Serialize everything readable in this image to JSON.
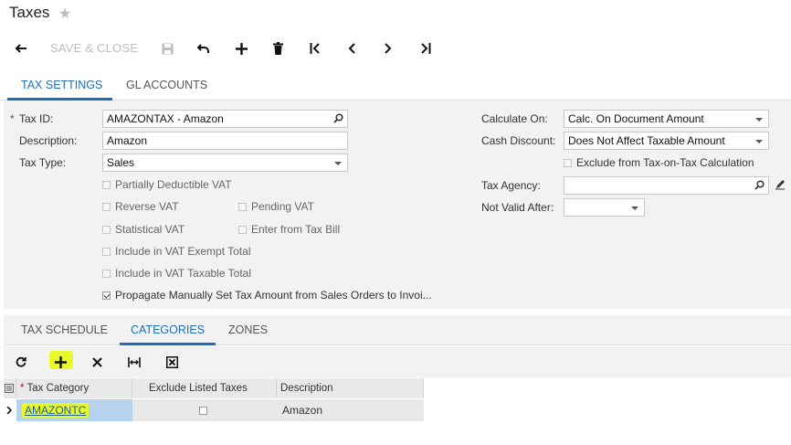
{
  "page": {
    "title": "Taxes"
  },
  "toolbar": {
    "save_close": "SAVE & CLOSE"
  },
  "tabs": {
    "tax_settings": "TAX SETTINGS",
    "gl_accounts": "GL ACCOUNTS"
  },
  "form": {
    "required_mark": "*",
    "tax_id_label": "Tax ID:",
    "tax_id_value": "AMAZONTAX - Amazon",
    "description_label": "Description:",
    "description_value": "Amazon",
    "tax_type_label": "Tax Type:",
    "tax_type_value": "Sales",
    "partially_deductible": "Partially Deductible VAT",
    "reverse_vat": "Reverse VAT",
    "pending_vat": "Pending VAT",
    "statistical_vat": "Statistical VAT",
    "enter_from_bill": "Enter from Tax Bill",
    "include_exempt": "Include in VAT Exempt Total",
    "include_taxable": "Include in VAT Taxable Total",
    "propagate": "Propagate Manually Set Tax Amount from Sales Orders to Invoi...",
    "calculate_on_label": "Calculate On:",
    "calculate_on_value": "Calc. On Document Amount",
    "cash_discount_label": "Cash Discount:",
    "cash_discount_value": "Does Not Affect Taxable Amount",
    "exclude_tax_on_tax": "Exclude from Tax-on-Tax Calculation",
    "tax_agency_label": "Tax Agency:",
    "tax_agency_value": "",
    "not_valid_after_label": "Not Valid After:",
    "not_valid_after_value": ""
  },
  "subtabs": {
    "schedule": "TAX SCHEDULE",
    "categories": "CATEGORIES",
    "zones": "ZONES"
  },
  "grid": {
    "columns": {
      "category": "Tax Category",
      "exclude": "Exclude Listed Taxes",
      "description": "Description"
    },
    "rows": [
      {
        "category": "AMAZONTC",
        "exclude": false,
        "description": "Amazon"
      }
    ]
  },
  "colors": {
    "accent": "#1d6fb8",
    "highlight": "#e8f82a"
  }
}
